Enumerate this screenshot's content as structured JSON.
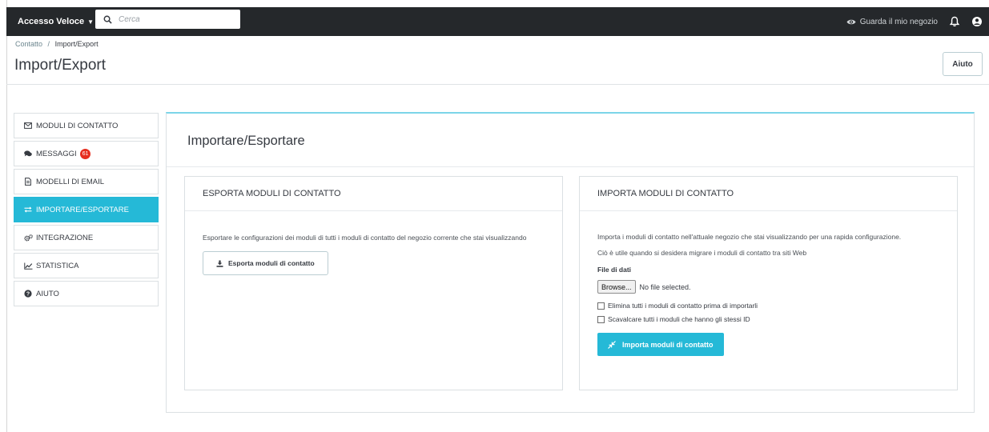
{
  "topbar": {
    "quick_access": "Accesso Veloce",
    "search_placeholder": "Cerca",
    "view_shop": "Guarda il mio negozio"
  },
  "breadcrumb": {
    "parent": "Contatto",
    "separator": "/",
    "current": "Import/Export"
  },
  "page_title": "Import/Export",
  "help_label": "Aiuto",
  "sidebar": {
    "items": [
      {
        "label": "MODULI DI CONTATTO",
        "icon": "envelope-icon"
      },
      {
        "label": "MESSAGGI",
        "icon": "comments-icon",
        "badge": "61"
      },
      {
        "label": "MODELLI DI EMAIL",
        "icon": "file-icon"
      },
      {
        "label": "IMPORTARE/ESPORTARE",
        "icon": "exchange-icon",
        "active": true
      },
      {
        "label": "INTEGRAZIONE",
        "icon": "cogs-icon"
      },
      {
        "label": "STATISTICA",
        "icon": "line-chart-icon"
      },
      {
        "label": "AIUTO",
        "icon": "question-circle-icon"
      }
    ]
  },
  "main": {
    "title": "Importare/Esportare",
    "export": {
      "heading": "ESPORTA MODULI DI CONTATTO",
      "description": "Esportare le configurazioni dei moduli di tutti i moduli di contatto del negozio corrente che stai visualizzando",
      "button": "Esporta moduli di contatto"
    },
    "import": {
      "heading": "IMPORTA MODULI DI CONTATTO",
      "description_1": "Importa i moduli di contatto nell'attuale negozio che stai visualizzando per una rapida configurazione.",
      "description_2": "Ciò è utile quando si desidera migrare i moduli di contatto tra siti Web",
      "file_label": "File di dati",
      "browse": "Browse...",
      "no_file": "No file selected.",
      "check_delete": "Elimina tutti i moduli di contatto prima di importarli",
      "check_override": "Scavalcare tutti i moduli che hanno gli stessi ID",
      "button": "Importa moduli di contatto"
    }
  },
  "colors": {
    "accent": "#25b9d7",
    "topbar": "#25282b",
    "badge": "#e62e1f"
  }
}
